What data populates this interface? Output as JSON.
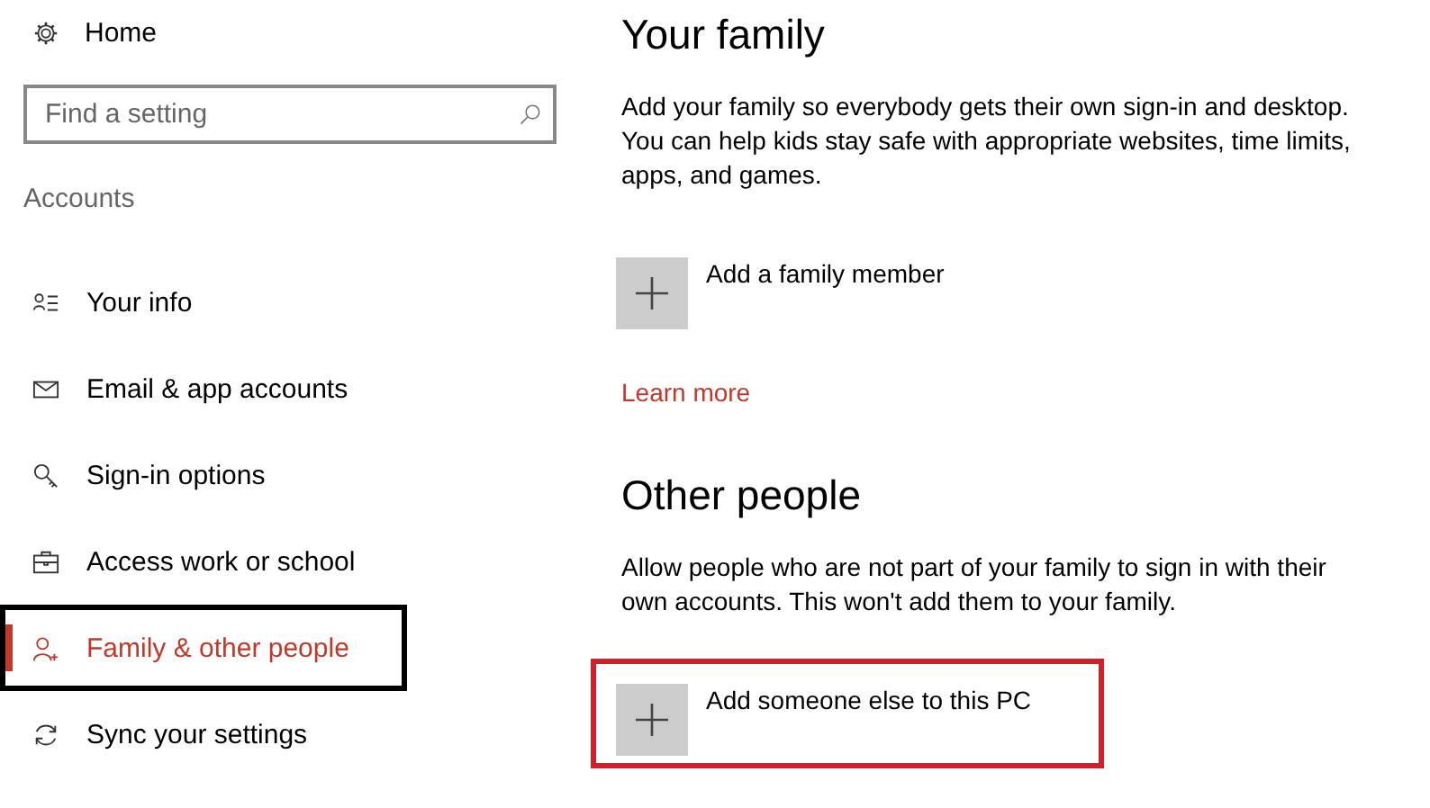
{
  "sidebar": {
    "home": "Home",
    "search": {
      "placeholder": "Find a setting"
    },
    "section": "Accounts",
    "items": [
      {
        "label": "Your info",
        "selected": false,
        "outlined": false
      },
      {
        "label": "Email & app accounts",
        "selected": false,
        "outlined": false
      },
      {
        "label": "Sign-in options",
        "selected": false,
        "outlined": false
      },
      {
        "label": "Access work or school",
        "selected": false,
        "outlined": false
      },
      {
        "label": "Family & other people",
        "selected": true,
        "outlined": true
      },
      {
        "label": "Sync your settings",
        "selected": false,
        "outlined": false
      }
    ]
  },
  "sections": [
    {
      "title": "Your family",
      "description": "Add your family so everybody gets their own sign-in and desktop. You can help kids stay safe with appropriate websites, time limits, apps, and games.",
      "action": {
        "label": "Add a family member",
        "outlined": false
      },
      "link": "Learn more"
    },
    {
      "title": "Other people",
      "description": "Allow people who are not part of your family to sign in with their own accounts. This won't add them to your family.",
      "action": {
        "label": "Add someone else to this PC",
        "outlined": true
      }
    }
  ]
}
